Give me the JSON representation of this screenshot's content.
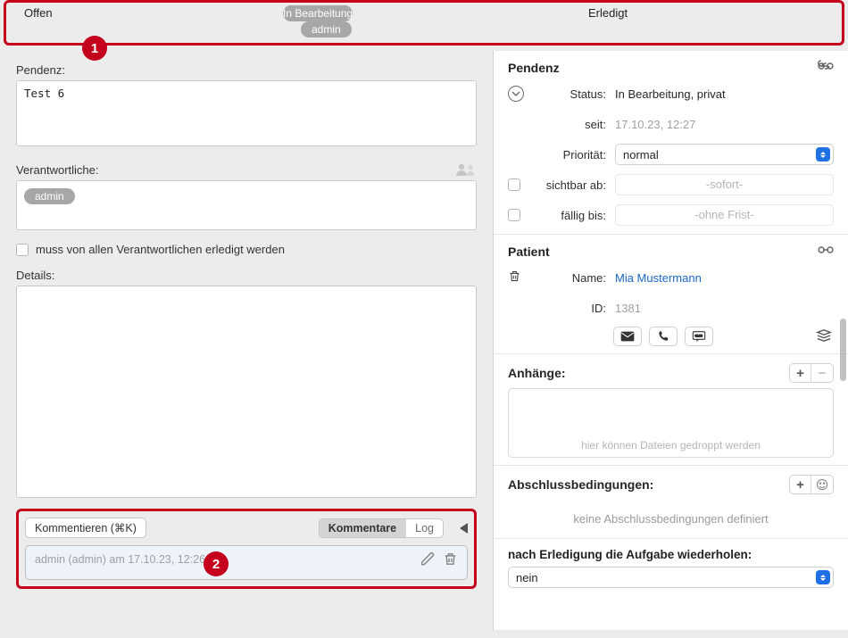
{
  "status_bar": {
    "open": "Offen",
    "in_progress": "In Bearbeitung",
    "done": "Erledigt",
    "admin": "admin"
  },
  "badges": {
    "b1": "1",
    "b2": "2"
  },
  "left": {
    "pendenz_label": "Pendenz:",
    "pendenz_value": "Test 6",
    "responsible_label": "Verantwortliche:",
    "responsible_admin": "admin",
    "must_all_label": "muss von allen Verantwortlichen erledigt werden",
    "details_label": "Details:",
    "comment_btn": "Kommentieren (⌘K)",
    "seg_comments": "Kommentare",
    "seg_log": "Log",
    "comment_meta": "admin (admin) am 17.10.23, 12:26"
  },
  "right": {
    "pendenz_title": "Pendenz",
    "status_label": "Status:",
    "status_value": "In Bearbeitung, privat",
    "since_label": "seit:",
    "since_value": "17.10.23, 12:27",
    "prio_label": "Priorität:",
    "prio_value": "normal",
    "visible_from_label": "sichtbar ab:",
    "visible_from_ph": "-sofort-",
    "due_label": "fällig bis:",
    "due_ph": "-ohne Frist-",
    "patient_title": "Patient",
    "name_label": "Name:",
    "name_value": "Mia Mustermann",
    "id_label": "ID:",
    "id_value": "1381",
    "attach_label": "Anhänge:",
    "dropzone_hint": "hier können Dateien gedroppt werden",
    "conditions_title": "Abschlussbedingungen:",
    "conditions_empty": "keine Abschlussbedingungen definiert",
    "repeat_title": "nach Erledigung die Aufgabe wiederholen:",
    "repeat_value": "nein"
  }
}
